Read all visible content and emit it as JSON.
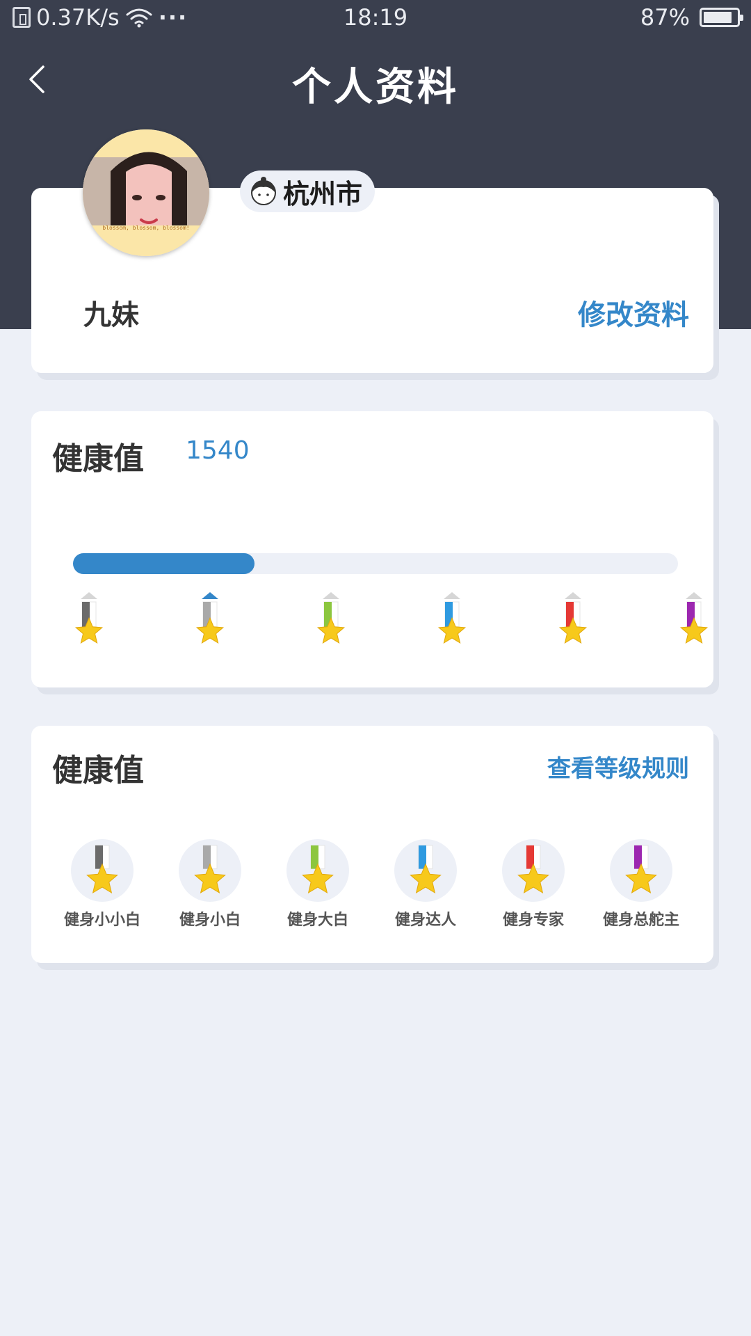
{
  "status_bar": {
    "speed": "0.37K/s",
    "more": "···",
    "time": "18:19",
    "battery": "87%",
    "battery_level": 0.87
  },
  "nav": {
    "title": "个人资料",
    "back_icon": "chevron-left-icon"
  },
  "profile": {
    "location": "杭州市",
    "name": "九妹",
    "edit_label": "修改资料",
    "avatar_caption": "blossom, blossom, blossom!"
  },
  "health": {
    "title": "健康值",
    "value": "1540",
    "progress": 0.3,
    "current_level_index": 1,
    "medal_colors": [
      "#6b6b6b",
      "#a9a9a9",
      "#8cc63f",
      "#2f9ae0",
      "#e53935",
      "#9c27b0"
    ]
  },
  "levels": {
    "title": "健康值",
    "rules_link": "查看等级规则",
    "badges": [
      {
        "label": "健身小小白",
        "color": "#6b6b6b"
      },
      {
        "label": "健身小白",
        "color": "#a9a9a9"
      },
      {
        "label": "健身大白",
        "color": "#8cc63f"
      },
      {
        "label": "健身达人",
        "color": "#2f9ae0"
      },
      {
        "label": "健身专家",
        "color": "#e53935"
      },
      {
        "label": "健身总舵主",
        "color": "#9c27b0"
      }
    ]
  },
  "colors": {
    "header": "#3a3f4e",
    "accent": "#3487c9",
    "background": "#edf0f7",
    "star": "#f7c91b"
  }
}
